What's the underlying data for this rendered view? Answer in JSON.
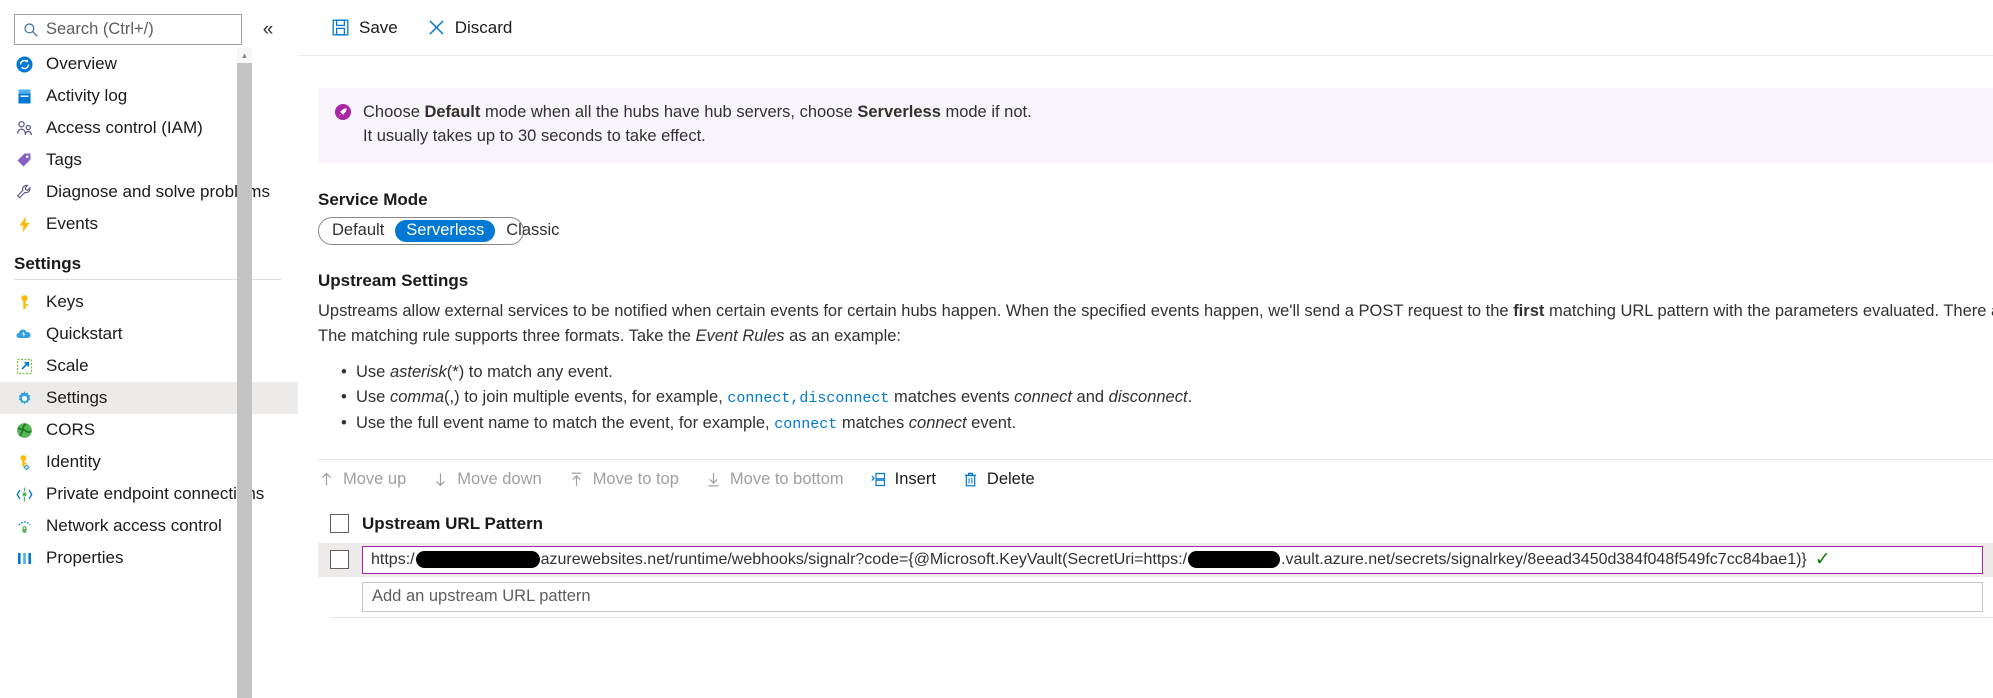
{
  "sidebar": {
    "search": {
      "placeholder": "Search (Ctrl+/)",
      "icon": "search-icon"
    },
    "collapse_label": "«",
    "items": [
      {
        "label": "Overview",
        "icon": "overview-icon"
      },
      {
        "label": "Activity log",
        "icon": "activity-log-icon"
      },
      {
        "label": "Access control (IAM)",
        "icon": "access-control-icon"
      },
      {
        "label": "Tags",
        "icon": "tags-icon"
      },
      {
        "label": "Diagnose and solve problems",
        "icon": "wrench-icon"
      },
      {
        "label": "Events",
        "icon": "lightning-icon"
      }
    ],
    "group_title": "Settings",
    "settings_items": [
      {
        "label": "Keys",
        "icon": "key-icon",
        "selected": false
      },
      {
        "label": "Quickstart",
        "icon": "cloud-icon",
        "selected": false
      },
      {
        "label": "Scale",
        "icon": "scale-icon",
        "selected": false
      },
      {
        "label": "Settings",
        "icon": "gear-icon",
        "selected": true
      },
      {
        "label": "CORS",
        "icon": "cors-globe-icon",
        "selected": false
      },
      {
        "label": "Identity",
        "icon": "identity-key-icon",
        "selected": false
      },
      {
        "label": "Private endpoint connections",
        "icon": "private-endpoint-icon",
        "selected": false
      },
      {
        "label": "Network access control",
        "icon": "network-access-icon",
        "selected": false
      },
      {
        "label": "Properties",
        "icon": "properties-icon",
        "selected": false
      }
    ]
  },
  "commandbar": {
    "save_label": "Save",
    "discard_label": "Discard"
  },
  "banner": {
    "line1_a": "Choose ",
    "line1_b": "Default",
    "line1_c": " mode when all the hubs have hub servers, choose ",
    "line1_d": "Serverless",
    "line1_e": " mode if not.",
    "line2": "It usually takes up to 30 seconds to take effect.",
    "accent_color": "#a626a4",
    "background_color": "#f9f3fb"
  },
  "service_mode": {
    "label": "Service Mode",
    "options": [
      "Default",
      "Serverless",
      "Classic"
    ],
    "selected": "Serverless",
    "accent_color": "#0078d4"
  },
  "upstream": {
    "heading": "Upstream Settings",
    "para1_a": "Upstreams allow external services to be notified when certain events for certain hubs happen. When the specified events happen, we'll send a POST request to the ",
    "para1_b": "first",
    "para1_c": " matching URL pattern with the parameters evaluated. There are",
    "para2_a": "The matching rule supports three formats. Take the ",
    "para2_b": "Event Rules",
    "para2_c": " as an example:",
    "bullets": [
      {
        "pre": "Use ",
        "em": "asterisk",
        "mid": "(*) to match any event.",
        "code1": "",
        "post": ""
      },
      {
        "pre": "Use ",
        "em": "comma",
        "mid": "(,) to join multiple events, for example, ",
        "code1": "connect,disconnect",
        "post": " matches events ",
        "em2": "connect",
        "post2": " and ",
        "em3": "disconnect",
        "post3": "."
      },
      {
        "pre": "Use the full event name to match the event, for example, ",
        "em": "",
        "mid": "",
        "code1": "connect",
        "post": " matches ",
        "em2": "connect",
        "post2": " event."
      }
    ]
  },
  "table_commands": [
    {
      "label": "Move up",
      "icon": "arrow-up-icon",
      "enabled": false
    },
    {
      "label": "Move down",
      "icon": "arrow-down-icon",
      "enabled": false
    },
    {
      "label": "Move to top",
      "icon": "arrow-to-top-icon",
      "enabled": false
    },
    {
      "label": "Move to bottom",
      "icon": "arrow-to-bottom-icon",
      "enabled": false
    },
    {
      "label": "Insert",
      "icon": "insert-row-icon",
      "enabled": true
    },
    {
      "label": "Delete",
      "icon": "trash-icon",
      "enabled": true
    }
  ],
  "grid": {
    "header_label": "Upstream URL Pattern",
    "row": {
      "url_part1": "https:/",
      "url_part2": "azurewebsites.net/runtime/webhooks/signalr?code={@Microsoft.KeyVault(SecretUri=https:/",
      "url_part3": ".vault.azure.net/secrets/signalrkey/8eead3450d384f048f549fc7cc84bae1)}",
      "valid_icon": "checkmark-icon",
      "valid_color": "#107c10",
      "border_color": "#a626a4"
    },
    "add_placeholder": "Add an upstream URL pattern"
  }
}
